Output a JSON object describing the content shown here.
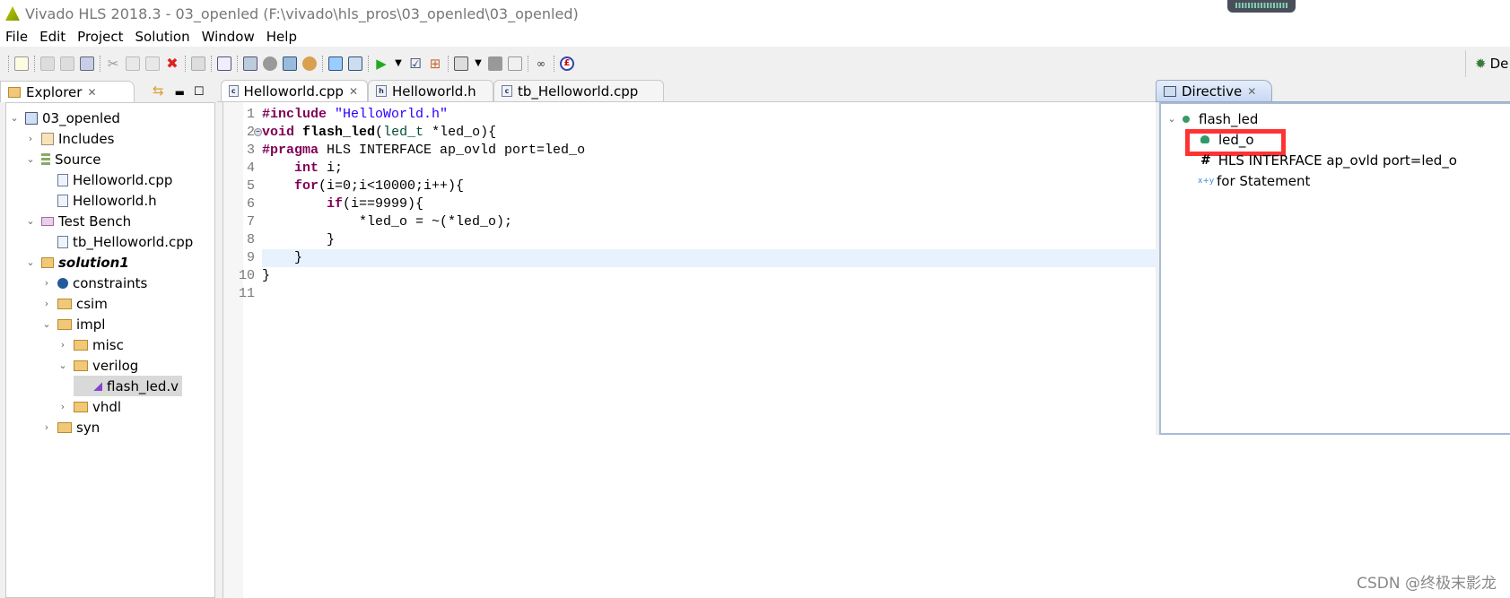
{
  "window": {
    "title": "Vivado HLS 2018.3 - 03_openled (F:\\vivado\\hls_pros\\03_openled\\03_openled)"
  },
  "menu": [
    "File",
    "Edit",
    "Project",
    "Solution",
    "Window",
    "Help"
  ],
  "toolbar": {
    "perspective_label": "De"
  },
  "explorer": {
    "tab_label": "Explorer",
    "tree": [
      {
        "label": "03_openled",
        "depth": 0,
        "expanded": true,
        "icon": "project-icon"
      },
      {
        "label": "Includes",
        "depth": 1,
        "expanded": false,
        "icon": "includes-icon"
      },
      {
        "label": "Source",
        "depth": 1,
        "expanded": true,
        "icon": "source-icon"
      },
      {
        "label": "Helloworld.cpp",
        "depth": 2,
        "icon": "cpp-file-icon"
      },
      {
        "label": "Helloworld.h",
        "depth": 2,
        "icon": "h-file-icon"
      },
      {
        "label": "Test Bench",
        "depth": 1,
        "expanded": true,
        "icon": "testbench-icon"
      },
      {
        "label": "tb_Helloworld.cpp",
        "depth": 2,
        "icon": "cpp-file-icon"
      },
      {
        "label": "solution1",
        "depth": 1,
        "expanded": true,
        "icon": "solution-folder-icon",
        "bold": true
      },
      {
        "label": "constraints",
        "depth": 2,
        "expanded": false,
        "icon": "gear-icon"
      },
      {
        "label": "csim",
        "depth": 2,
        "expanded": false,
        "icon": "folder-icon"
      },
      {
        "label": "impl",
        "depth": 2,
        "expanded": true,
        "icon": "folder-icon"
      },
      {
        "label": "misc",
        "depth": 3,
        "expanded": false,
        "icon": "folder-icon"
      },
      {
        "label": "verilog",
        "depth": 3,
        "expanded": true,
        "icon": "folder-icon"
      },
      {
        "label": "flash_led.v",
        "depth": 4,
        "icon": "rtl-file-icon",
        "selected": true
      },
      {
        "label": "vhdl",
        "depth": 3,
        "expanded": false,
        "icon": "folder-icon"
      },
      {
        "label": "syn",
        "depth": 2,
        "expanded": false,
        "icon": "folder-icon"
      }
    ]
  },
  "editor": {
    "tabs": [
      {
        "label": "Helloworld.cpp",
        "active": true
      },
      {
        "label": "Helloworld.h"
      },
      {
        "label": "tb_Helloworld.cpp"
      }
    ],
    "lines": [
      {
        "n": "1",
        "t": [
          [
            "kw",
            "#include"
          ],
          [
            "",
            " "
          ],
          [
            "str",
            "\"HelloWorld.h\""
          ]
        ]
      },
      {
        "n": "2",
        "t": [
          [
            "kw",
            "void"
          ],
          [
            "",
            " "
          ],
          [
            "fn",
            "flash_led"
          ],
          [
            "",
            "("
          ],
          [
            "ty",
            "led_t"
          ],
          [
            "",
            " *led_o){"
          ]
        ]
      },
      {
        "n": "3",
        "t": [
          [
            "kw",
            "#pragma"
          ],
          [
            "",
            " HLS INTERFACE ap_ovld port=led_o"
          ]
        ]
      },
      {
        "n": "4",
        "t": [
          [
            "",
            "    "
          ],
          [
            "kw",
            "int"
          ],
          [
            "",
            " i;"
          ]
        ]
      },
      {
        "n": "5",
        "t": [
          [
            "",
            "    "
          ],
          [
            "kw",
            "for"
          ],
          [
            "",
            "(i=0;i<10000;i++){"
          ]
        ]
      },
      {
        "n": "6",
        "t": [
          [
            "",
            "        "
          ],
          [
            "kw",
            "if"
          ],
          [
            "",
            "(i==9999){"
          ]
        ]
      },
      {
        "n": "7",
        "t": [
          [
            "",
            "            *led_o = ~(*led_o);"
          ]
        ]
      },
      {
        "n": "8",
        "t": [
          [
            "",
            "        }"
          ]
        ]
      },
      {
        "n": "9",
        "t": [
          [
            "",
            "    }"
          ]
        ]
      },
      {
        "n": "10",
        "t": [
          [
            "",
            "}"
          ]
        ]
      },
      {
        "n": "11",
        "t": []
      }
    ],
    "current_line": 9
  },
  "directive": {
    "tab_label": "Directive",
    "items": [
      {
        "label": "flash_led",
        "icon": "function-dot-icon"
      },
      {
        "label": "led_o",
        "icon": "port-dot-icon",
        "highlighted": true
      },
      {
        "label": "HLS INTERFACE ap_ovld port=led_o",
        "icon": "hash-icon"
      },
      {
        "label": "for Statement",
        "icon": "loop-icon"
      }
    ],
    "highlight_color": "#ff3333"
  },
  "watermark": "CSDN @终极末影龙"
}
